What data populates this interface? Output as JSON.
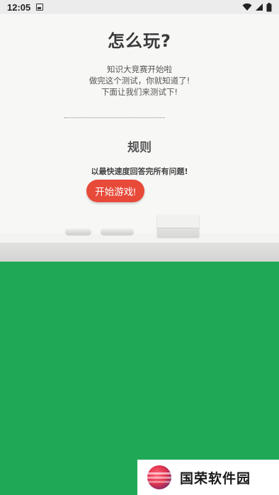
{
  "status_bar": {
    "time": "12:05",
    "icons": [
      "app-notification-icon",
      "wifi-icon",
      "signal-icon",
      "battery-icon"
    ]
  },
  "board": {
    "title": "怎么玩?",
    "intro_lines": [
      "知识大竞赛开始啦",
      "做完这个测试，你就知道了!",
      "下面让我们来测试下!"
    ],
    "rules_heading": "规则",
    "rules_text": "以最快速度回答完所有问题!",
    "start_button_label": "开始游戏!"
  },
  "watermark": {
    "text": "国荣软件园",
    "logo_icon": "globe-logo-icon"
  },
  "colors": {
    "green_area": "#1fa956",
    "start_button": "#e84a3a",
    "board": "#f7f8f6"
  }
}
